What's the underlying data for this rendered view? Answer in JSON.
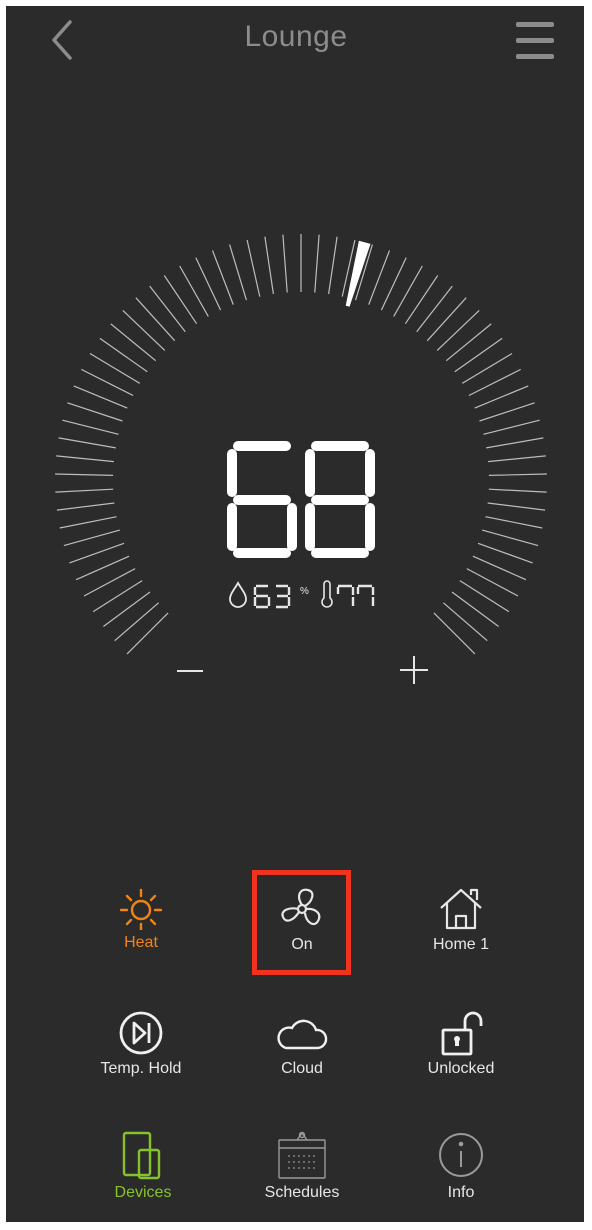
{
  "header": {
    "title": "Lounge"
  },
  "thermostat": {
    "setpoint": "68",
    "humidity": "63",
    "humidity_unit": "%",
    "indoor_temp": "77"
  },
  "controls": {
    "mode_label": "Heat",
    "fan_label": "On",
    "home_label": "Home 1",
    "hold_label": "Temp. Hold",
    "cloud_label": "Cloud",
    "lock_label": "Unlocked"
  },
  "nav": {
    "devices_label": "Devices",
    "schedules_label": "Schedules",
    "info_label": "Info"
  },
  "colors": {
    "background": "#2b2b2b",
    "accent_heat": "#f08416",
    "accent_active_nav": "#88c22a",
    "highlight": "#f0321e",
    "title": "#8c8c8c"
  }
}
